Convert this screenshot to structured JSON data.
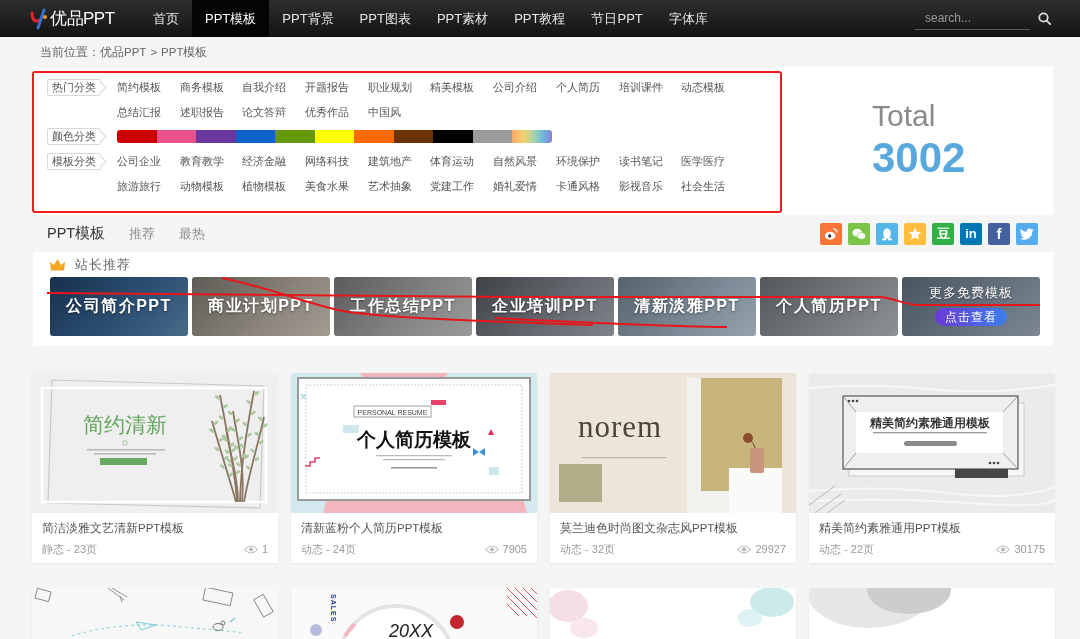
{
  "header": {
    "logo_text": "优品PPT",
    "nav": [
      {
        "label": "首页",
        "selected": false
      },
      {
        "label": "PPT模板",
        "selected": true
      },
      {
        "label": "PPT背景",
        "selected": false
      },
      {
        "label": "PPT图表",
        "selected": false
      },
      {
        "label": "PPT素材",
        "selected": false
      },
      {
        "label": "PPT教程",
        "selected": false
      },
      {
        "label": "节日PPT",
        "selected": false
      },
      {
        "label": "字体库",
        "selected": false
      }
    ],
    "search": {
      "placeholder": "search..."
    }
  },
  "breadcrumb": {
    "prefix": "当前位置：",
    "links": [
      "优品PPT",
      "PPT模板"
    ],
    "separator": ">"
  },
  "categories": {
    "highlighted": true,
    "groups": [
      {
        "kind": "links",
        "label": "热门分类",
        "items": [
          "简约模板",
          "商务模板",
          "自我介绍",
          "开题报告",
          "职业规划",
          "精美模板",
          "公司介绍",
          "个人简历",
          "培训课件",
          "动态模板",
          "总结汇报",
          "述职报告",
          "论文答辩",
          "优秀作品",
          "中国风"
        ]
      },
      {
        "kind": "colors",
        "label": "颜色分类",
        "swatches": [
          {
            "kind": "solid",
            "color": "#cc0000"
          },
          {
            "kind": "solid",
            "color": "#e9518a"
          },
          {
            "kind": "solid",
            "color": "#6b36a0"
          },
          {
            "kind": "solid",
            "color": "#0f64cc"
          },
          {
            "kind": "solid",
            "color": "#65990b"
          },
          {
            "kind": "solid",
            "color": "#ffff00"
          },
          {
            "kind": "solid",
            "color": "#ff6a00"
          },
          {
            "kind": "solid",
            "color": "#6b3305"
          },
          {
            "kind": "solid",
            "color": "#000000"
          },
          {
            "kind": "solid",
            "color": "#9b9b9b"
          },
          {
            "kind": "gradient"
          }
        ]
      },
      {
        "kind": "links",
        "label": "模板分类",
        "items": [
          "公司企业",
          "教育教学",
          "经济金融",
          "网络科技",
          "建筑地产",
          "体育运动",
          "自然风景",
          "环境保护",
          "读书笔记",
          "医学医疗",
          "旅游旅行",
          "动物模板",
          "植物模板",
          "美食水果",
          "艺术抽象",
          "党建工作",
          "婚礼爱情",
          "卡通风格",
          "影视音乐",
          "社会生活"
        ]
      }
    ]
  },
  "total": {
    "label": "Total",
    "value": "3002"
  },
  "tabs": [
    {
      "label": "PPT模板",
      "selected": true
    },
    {
      "label": "推荐",
      "selected": false
    },
    {
      "label": "最热",
      "selected": false
    }
  ],
  "share_buttons": [
    {
      "kind": "weibo",
      "color": "#fb7537"
    },
    {
      "kind": "wechat",
      "color": "#7bc549"
    },
    {
      "kind": "qq",
      "color": "#56b6e7"
    },
    {
      "kind": "qzone",
      "color": "#fdbe3d"
    },
    {
      "kind": "douban",
      "color": "#33b045",
      "glyph": "豆"
    },
    {
      "kind": "linkedin",
      "color": "#0077b5",
      "glyph": "in"
    },
    {
      "kind": "facebook",
      "color": "#44619d",
      "glyph": "f"
    },
    {
      "kind": "twitter",
      "color": "#55acee"
    }
  ],
  "featured": {
    "title": "站长推荐",
    "crossed_out": true,
    "tiles": [
      {
        "kind": "photo",
        "label": "公司简介PPT"
      },
      {
        "kind": "photo",
        "label": "商业计划PPT"
      },
      {
        "kind": "photo",
        "label": "工作总结PPT"
      },
      {
        "kind": "photo",
        "label": "企业培训PPT"
      },
      {
        "kind": "photo",
        "label": "清新淡雅PPT"
      },
      {
        "kind": "photo",
        "label": "个人简历PPT"
      },
      {
        "kind": "more",
        "label": "更多免费模板",
        "button": "点击查看"
      }
    ]
  },
  "cards": [
    {
      "thumbnail": {
        "kind": "willow",
        "title": "简约清新"
      },
      "title": "简洁淡雅文艺清新PPT模板",
      "meta": "静态 - 23页",
      "views": "1"
    },
    {
      "thumbnail": {
        "kind": "resume",
        "tag": "PERSONAL RESUME",
        "title": "个人简历模板"
      },
      "title": "清新蓝粉个人简历PPT模板",
      "meta": "动态 - 24页",
      "views": "7905"
    },
    {
      "thumbnail": {
        "kind": "vase",
        "title": "norem"
      },
      "title": "莫兰迪色时尚图文杂志风PPT模板",
      "meta": "动态 - 32页",
      "views": "29927"
    },
    {
      "thumbnail": {
        "kind": "frame",
        "title": "精美简约素雅通用模板"
      },
      "title": "精美简约素雅通用PPT模板",
      "meta": "动态 - 22页",
      "views": "30175"
    }
  ],
  "next_row_cards": [
    {
      "thumbnail": {
        "kind": "sketch"
      }
    },
    {
      "thumbnail": {
        "kind": "sales",
        "side_text": "SALES",
        "title": "20XX"
      }
    },
    {
      "thumbnail": {
        "kind": "watercolor"
      }
    },
    {
      "thumbnail": {
        "kind": "circles"
      }
    }
  ]
}
